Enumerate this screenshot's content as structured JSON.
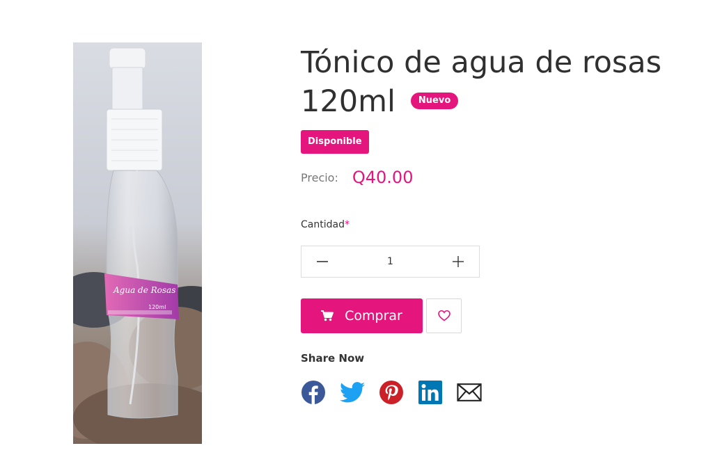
{
  "product": {
    "title": "Tónico de agua de rosas 120ml",
    "badge": "Nuevo",
    "stock": "Disponible",
    "price_label": "Precio:",
    "price": "Q40.00",
    "image_label": {
      "line1": "Agua de Rosas",
      "line2": "120ml"
    }
  },
  "quantity": {
    "label": "Cantidad",
    "required_mark": "*",
    "value": "1"
  },
  "actions": {
    "buy_label": "Comprar"
  },
  "share": {
    "label": "Share Now",
    "networks": [
      "facebook-icon",
      "twitter-icon",
      "pinterest-icon",
      "linkedin-icon",
      "email-icon"
    ]
  },
  "colors": {
    "accent": "#e4167d",
    "facebook": "#3b5998",
    "twitter": "#1da1f2",
    "pinterest": "#cb2027",
    "linkedin": "#0077b5"
  }
}
